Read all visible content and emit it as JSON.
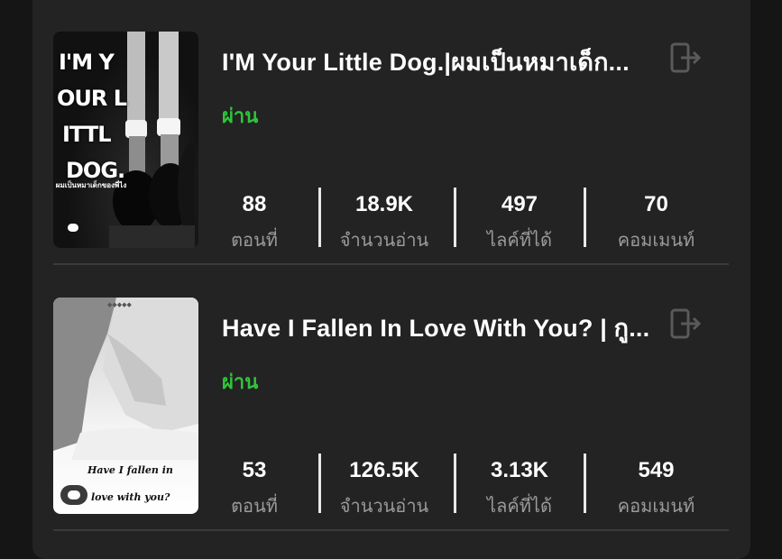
{
  "stories": [
    {
      "title": "I'M Your Little Dog.|ผมเป็นหมาเด็ก...",
      "status": "ผ่าน",
      "cover": {
        "lines": [
          "I'M Y",
          "OUR L",
          "ITTL",
          "DOG."
        ],
        "subtitle": "ผมเป็นหมาเด็กของพี่ไง"
      },
      "stats": [
        {
          "value": "88",
          "label": "ตอนที่"
        },
        {
          "value": "18.9K",
          "label": "จำนวนอ่าน"
        },
        {
          "value": "497",
          "label": "ไลค์ที่ได้"
        },
        {
          "value": "70",
          "label": "คอมเมนท์"
        }
      ]
    },
    {
      "title": "Have I Fallen In Love With You? | กู...",
      "status": "ผ่าน",
      "cover": {
        "line1": "Have I fallen in",
        "line2": "love with you?"
      },
      "stats": [
        {
          "value": "53",
          "label": "ตอนที่"
        },
        {
          "value": "126.5K",
          "label": "จำนวนอ่าน"
        },
        {
          "value": "3.13K",
          "label": "ไลค์ที่ได้"
        },
        {
          "value": "549",
          "label": "คอมเมนท์"
        }
      ]
    }
  ],
  "colors": {
    "status": "#2fc43a",
    "background": "#232323",
    "text": "#ffffff",
    "label": "#9a9a9a"
  },
  "icons": {
    "exit": "exit-icon",
    "chat": "chat-bubble-icon"
  }
}
